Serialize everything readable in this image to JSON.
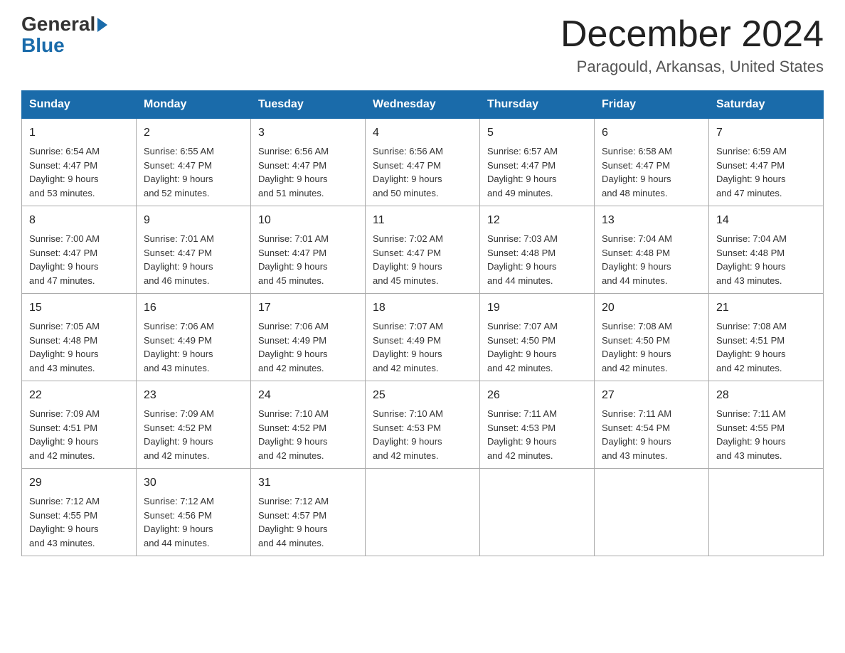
{
  "header": {
    "logo_general": "General",
    "logo_blue": "Blue",
    "month": "December 2024",
    "location": "Paragould, Arkansas, United States"
  },
  "weekdays": [
    "Sunday",
    "Monday",
    "Tuesday",
    "Wednesday",
    "Thursday",
    "Friday",
    "Saturday"
  ],
  "weeks": [
    [
      {
        "day": "1",
        "sunrise": "6:54 AM",
        "sunset": "4:47 PM",
        "daylight": "9 hours and 53 minutes."
      },
      {
        "day": "2",
        "sunrise": "6:55 AM",
        "sunset": "4:47 PM",
        "daylight": "9 hours and 52 minutes."
      },
      {
        "day": "3",
        "sunrise": "6:56 AM",
        "sunset": "4:47 PM",
        "daylight": "9 hours and 51 minutes."
      },
      {
        "day": "4",
        "sunrise": "6:56 AM",
        "sunset": "4:47 PM",
        "daylight": "9 hours and 50 minutes."
      },
      {
        "day": "5",
        "sunrise": "6:57 AM",
        "sunset": "4:47 PM",
        "daylight": "9 hours and 49 minutes."
      },
      {
        "day": "6",
        "sunrise": "6:58 AM",
        "sunset": "4:47 PM",
        "daylight": "9 hours and 48 minutes."
      },
      {
        "day": "7",
        "sunrise": "6:59 AM",
        "sunset": "4:47 PM",
        "daylight": "9 hours and 47 minutes."
      }
    ],
    [
      {
        "day": "8",
        "sunrise": "7:00 AM",
        "sunset": "4:47 PM",
        "daylight": "9 hours and 47 minutes."
      },
      {
        "day": "9",
        "sunrise": "7:01 AM",
        "sunset": "4:47 PM",
        "daylight": "9 hours and 46 minutes."
      },
      {
        "day": "10",
        "sunrise": "7:01 AM",
        "sunset": "4:47 PM",
        "daylight": "9 hours and 45 minutes."
      },
      {
        "day": "11",
        "sunrise": "7:02 AM",
        "sunset": "4:47 PM",
        "daylight": "9 hours and 45 minutes."
      },
      {
        "day": "12",
        "sunrise": "7:03 AM",
        "sunset": "4:48 PM",
        "daylight": "9 hours and 44 minutes."
      },
      {
        "day": "13",
        "sunrise": "7:04 AM",
        "sunset": "4:48 PM",
        "daylight": "9 hours and 44 minutes."
      },
      {
        "day": "14",
        "sunrise": "7:04 AM",
        "sunset": "4:48 PM",
        "daylight": "9 hours and 43 minutes."
      }
    ],
    [
      {
        "day": "15",
        "sunrise": "7:05 AM",
        "sunset": "4:48 PM",
        "daylight": "9 hours and 43 minutes."
      },
      {
        "day": "16",
        "sunrise": "7:06 AM",
        "sunset": "4:49 PM",
        "daylight": "9 hours and 43 minutes."
      },
      {
        "day": "17",
        "sunrise": "7:06 AM",
        "sunset": "4:49 PM",
        "daylight": "9 hours and 42 minutes."
      },
      {
        "day": "18",
        "sunrise": "7:07 AM",
        "sunset": "4:49 PM",
        "daylight": "9 hours and 42 minutes."
      },
      {
        "day": "19",
        "sunrise": "7:07 AM",
        "sunset": "4:50 PM",
        "daylight": "9 hours and 42 minutes."
      },
      {
        "day": "20",
        "sunrise": "7:08 AM",
        "sunset": "4:50 PM",
        "daylight": "9 hours and 42 minutes."
      },
      {
        "day": "21",
        "sunrise": "7:08 AM",
        "sunset": "4:51 PM",
        "daylight": "9 hours and 42 minutes."
      }
    ],
    [
      {
        "day": "22",
        "sunrise": "7:09 AM",
        "sunset": "4:51 PM",
        "daylight": "9 hours and 42 minutes."
      },
      {
        "day": "23",
        "sunrise": "7:09 AM",
        "sunset": "4:52 PM",
        "daylight": "9 hours and 42 minutes."
      },
      {
        "day": "24",
        "sunrise": "7:10 AM",
        "sunset": "4:52 PM",
        "daylight": "9 hours and 42 minutes."
      },
      {
        "day": "25",
        "sunrise": "7:10 AM",
        "sunset": "4:53 PM",
        "daylight": "9 hours and 42 minutes."
      },
      {
        "day": "26",
        "sunrise": "7:11 AM",
        "sunset": "4:53 PM",
        "daylight": "9 hours and 42 minutes."
      },
      {
        "day": "27",
        "sunrise": "7:11 AM",
        "sunset": "4:54 PM",
        "daylight": "9 hours and 43 minutes."
      },
      {
        "day": "28",
        "sunrise": "7:11 AM",
        "sunset": "4:55 PM",
        "daylight": "9 hours and 43 minutes."
      }
    ],
    [
      {
        "day": "29",
        "sunrise": "7:12 AM",
        "sunset": "4:55 PM",
        "daylight": "9 hours and 43 minutes."
      },
      {
        "day": "30",
        "sunrise": "7:12 AM",
        "sunset": "4:56 PM",
        "daylight": "9 hours and 44 minutes."
      },
      {
        "day": "31",
        "sunrise": "7:12 AM",
        "sunset": "4:57 PM",
        "daylight": "9 hours and 44 minutes."
      },
      null,
      null,
      null,
      null
    ]
  ]
}
